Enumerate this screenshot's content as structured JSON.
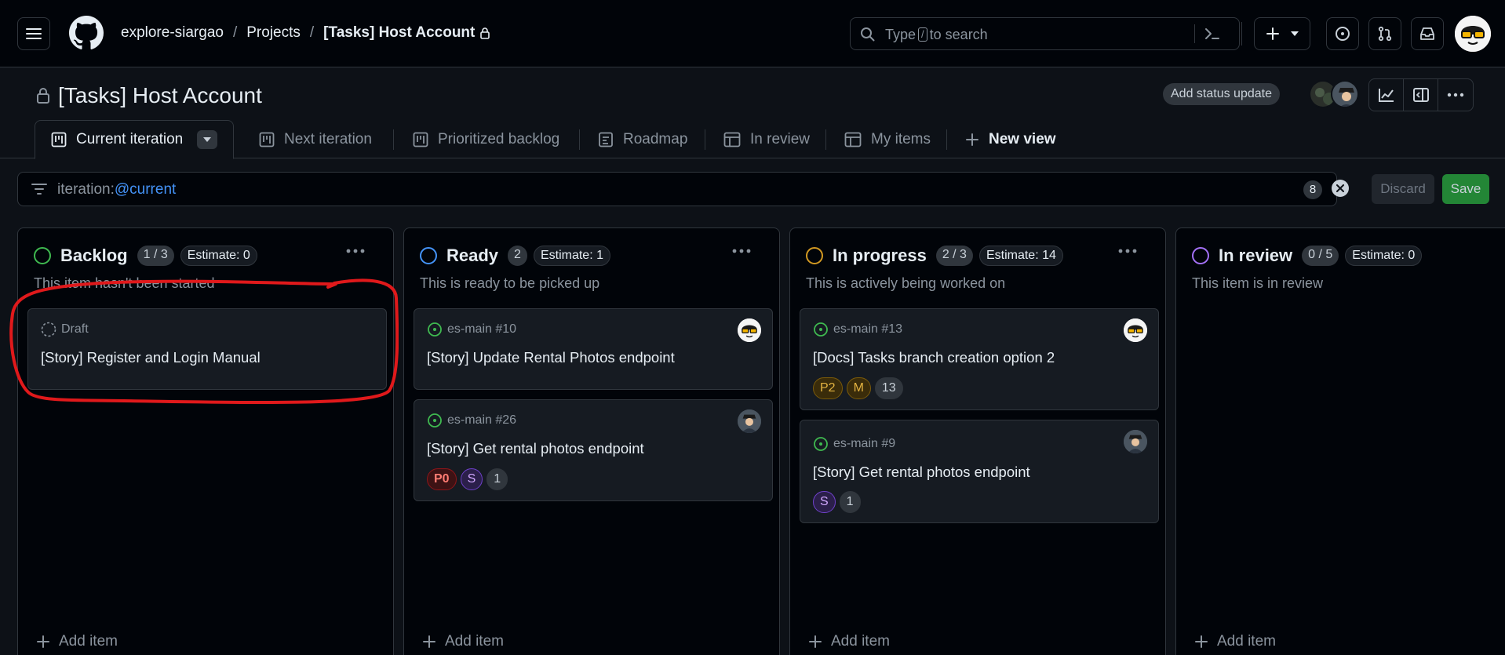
{
  "header": {
    "breadcrumbs": [
      "explore-siargao",
      "Projects",
      "[Tasks] Host Account"
    ],
    "search": {
      "before": "Type",
      "key": "/",
      "after": "to search"
    },
    "icons": [
      "hamburger-icon",
      "github-logo",
      "command-palette-icon",
      "plus-icon",
      "chevron-down-icon",
      "issues-icon",
      "pull-requests-icon",
      "inbox-icon",
      "user-avatar"
    ]
  },
  "project": {
    "title": "[Tasks] Host Account",
    "status_update_label": "Add status update"
  },
  "tabs": [
    {
      "label": "Current iteration",
      "icon": "board-icon",
      "active": true
    },
    {
      "label": "Next iteration",
      "icon": "board-icon"
    },
    {
      "label": "Prioritized backlog",
      "icon": "board-icon"
    },
    {
      "label": "Roadmap",
      "icon": "roadmap-icon"
    },
    {
      "label": "In review",
      "icon": "table-icon"
    },
    {
      "label": "My items",
      "icon": "table-icon"
    },
    {
      "label": "New view",
      "icon": "plus-icon"
    }
  ],
  "filter": {
    "key": "iteration:",
    "value": "@current",
    "count": "8",
    "discard_label": "Discard",
    "save_label": "Save"
  },
  "columns": [
    {
      "name": "Backlog",
      "color": "#3fb950",
      "count": "1 / 3",
      "estimate": "Estimate: 0",
      "description": "This item hasn't been started",
      "add_label": "Add item",
      "cards": [
        {
          "meta": "Draft",
          "title": "[Story] Register and Login Manual",
          "labels": []
        }
      ]
    },
    {
      "name": "Ready",
      "color": "#4493f8",
      "count": "2",
      "estimate": "Estimate: 1",
      "description": "This is ready to be picked up",
      "add_label": "Add item",
      "cards": [
        {
          "meta": "es-main #10",
          "title": "[Story] Update Rental Photos endpoint",
          "labels": []
        },
        {
          "meta": "es-main #26",
          "title": "[Story] Get rental photos endpoint",
          "labels": [
            "P0",
            "S",
            "1"
          ]
        }
      ]
    },
    {
      "name": "In progress",
      "color": "#d29922",
      "count": "2 / 3",
      "estimate": "Estimate: 14",
      "description": "This is actively being worked on",
      "add_label": "Add item",
      "cards": [
        {
          "meta": "es-main #13",
          "title": "[Docs] Tasks branch creation option 2",
          "labels": [
            "P2",
            "M",
            "13"
          ]
        },
        {
          "meta": "es-main #9",
          "title": "[Story] Get rental photos endpoint",
          "labels": [
            "S",
            "1"
          ]
        }
      ]
    },
    {
      "name": "In review",
      "color": "#a371f7",
      "count": "0 / 5",
      "estimate": "Estimate: 0",
      "description": "This item is in review",
      "add_label": "Add item",
      "cards": []
    }
  ],
  "colors": {
    "accent": "#4493f8",
    "save": "#238636",
    "annotation": "#e0191b"
  }
}
